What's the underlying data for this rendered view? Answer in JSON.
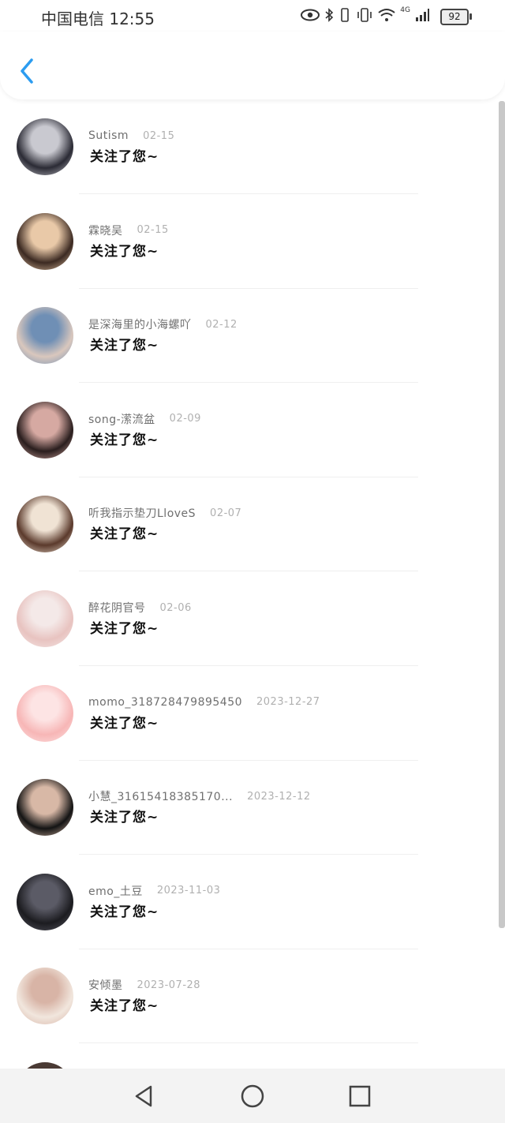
{
  "status_bar": {
    "carrier_time": "中国电信 12:55",
    "battery": "92",
    "network": "4G"
  },
  "header": {
    "back_icon": "chevron-left-icon",
    "accent": "#2c9cf0"
  },
  "notifications": [
    {
      "name": "Sutism",
      "date": "02-15",
      "message": "关注了您~",
      "avatar_colors": [
        "#2b2b35",
        "#c9c9d0"
      ]
    },
    {
      "name": "霖晓吴",
      "date": "02-15",
      "message": "关注了您~",
      "avatar_colors": [
        "#3c2a22",
        "#e9c9a8"
      ]
    },
    {
      "name": "是深海里的小海螺吖",
      "date": "02-12",
      "message": "关注了您~",
      "avatar_colors": [
        "#d9c7bd",
        "#6f8fb5"
      ]
    },
    {
      "name": "song-潆流盆",
      "date": "02-09",
      "message": "关注了您~",
      "avatar_colors": [
        "#2a1e1e",
        "#d6a9a2"
      ]
    },
    {
      "name": "听我指示垫刀LloveS",
      "date": "02-07",
      "message": "关注了您~",
      "avatar_colors": [
        "#5b3a2c",
        "#f0e3d4"
      ]
    },
    {
      "name": "醉花阴官号",
      "date": "02-06",
      "message": "关注了您~",
      "avatar_colors": [
        "#e8c3c0",
        "#f4e9e8"
      ]
    },
    {
      "name": "momo_318728479895450",
      "date": "2023-12-27",
      "message": "关注了您~",
      "avatar_colors": [
        "#f7b6b6",
        "#fde4e4"
      ]
    },
    {
      "name": "小慧_31615418385170...",
      "date": "2023-12-12",
      "message": "关注了您~",
      "avatar_colors": [
        "#141414",
        "#d8b8a6"
      ]
    },
    {
      "name": "emo_土豆",
      "date": "2023-11-03",
      "message": "关注了您~",
      "avatar_colors": [
        "#1c1c20",
        "#5b5b66"
      ]
    },
    {
      "name": "安倾墨",
      "date": "2023-07-28",
      "message": "关注了您~",
      "avatar_colors": [
        "#f1e6dd",
        "#d8b4a6"
      ]
    }
  ],
  "nav_bar": {
    "back_icon": "triangle-back-icon",
    "home_icon": "circle-home-icon",
    "recents_icon": "square-recents-icon"
  }
}
